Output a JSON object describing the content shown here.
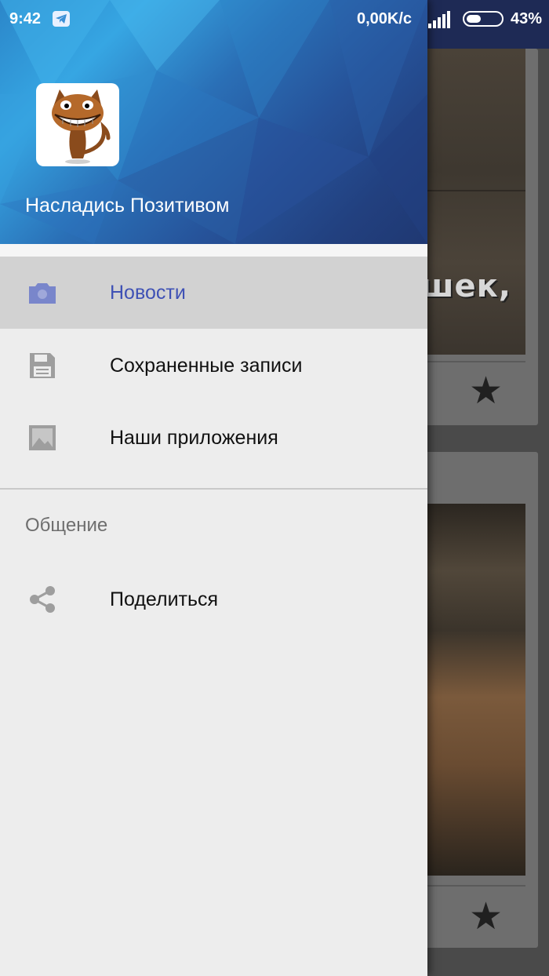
{
  "status_bar": {
    "time": "9:42",
    "network_speed": "0,00K/c",
    "battery_percent": "43%",
    "battery_level": 0.43,
    "icons": [
      "telegram-icon",
      "signal-icon",
      "battery-icon"
    ]
  },
  "background_feed": {
    "card1_caption": "шек,"
  },
  "drawer": {
    "app_name": "Насладись Позитивом",
    "items": [
      {
        "label": "Новости",
        "icon": "camera-icon",
        "active": true
      },
      {
        "label": "Сохраненные записи",
        "icon": "save-icon",
        "active": false
      },
      {
        "label": "Наши приложения",
        "icon": "image-icon",
        "active": false
      }
    ],
    "section_title": "Общение",
    "section_items": [
      {
        "label": "Поделиться",
        "icon": "share-icon"
      }
    ]
  },
  "colors": {
    "accent": "#3f51b5",
    "active_row": "#d2d2d2",
    "drawer_bg": "#ededed",
    "icon_gray": "#9e9e9e"
  }
}
